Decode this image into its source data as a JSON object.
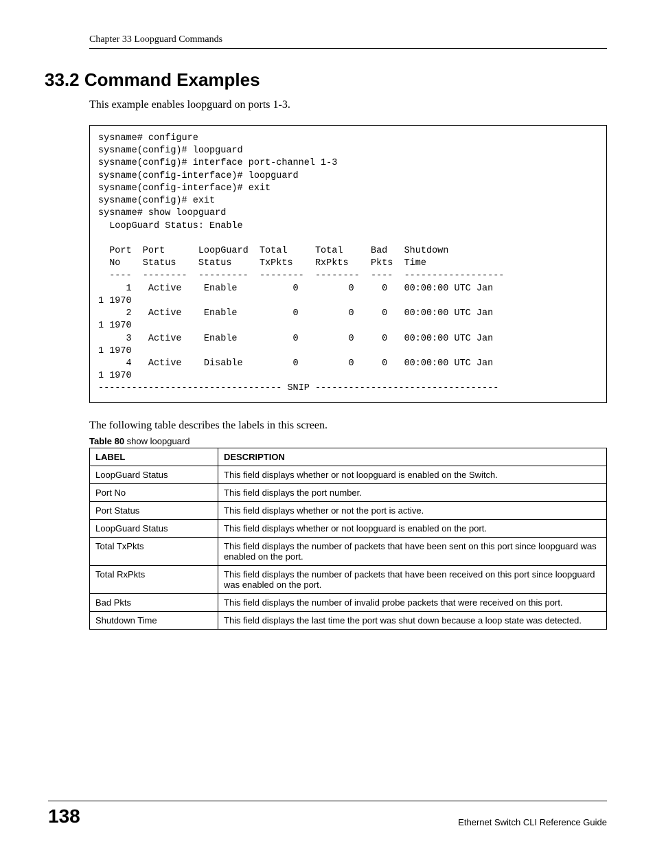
{
  "header": {
    "chapter": "Chapter 33 Loopguard Commands"
  },
  "section": {
    "title": "33.2  Command Examples",
    "intro": "This example enables loopguard on ports 1-3."
  },
  "code": "sysname# configure\nsysname(config)# loopguard\nsysname(config)# interface port-channel 1-3\nsysname(config-interface)# loopguard\nsysname(config-interface)# exit\nsysname(config)# exit\nsysname# show loopguard\n  LoopGuard Status: Enable\n\n  Port  Port      LoopGuard  Total     Total     Bad   Shutdown\n  No    Status    Status     TxPkts    RxPkts    Pkts  Time\n  ----  --------  ---------  --------  --------  ----  ------------------\n     1   Active    Enable          0         0     0   00:00:00 UTC Jan\n1 1970\n     2   Active    Enable          0         0     0   00:00:00 UTC Jan\n1 1970\n     3   Active    Enable          0         0     0   00:00:00 UTC Jan\n1 1970\n     4   Active    Disable         0         0     0   00:00:00 UTC Jan\n1 1970\n--------------------------------- SNIP ---------------------------------",
  "after_code": "The following table describes the labels in this screen.",
  "table": {
    "caption_bold": "Table 80",
    "caption_rest": "   show loopguard",
    "head_label": "LABEL",
    "head_desc": "DESCRIPTION",
    "rows": [
      {
        "label": "LoopGuard Status",
        "desc": "This field displays whether or not loopguard is enabled on the Switch."
      },
      {
        "label": "Port No",
        "desc": "This field displays the port number."
      },
      {
        "label": "Port Status",
        "desc": "This field displays whether or not the port is active."
      },
      {
        "label": "LoopGuard Status",
        "desc": "This field displays whether or not loopguard is enabled on the port."
      },
      {
        "label": "Total TxPkts",
        "desc": "This field displays the number of packets that have been sent on this port since loopguard was enabled on the port."
      },
      {
        "label": "Total RxPkts",
        "desc": "This field displays the number of packets that have been received on this port since loopguard was enabled on the port."
      },
      {
        "label": "Bad Pkts",
        "desc": "This field displays the number of invalid probe packets that were received on this port."
      },
      {
        "label": "Shutdown Time",
        "desc": "This field displays the last time the port was shut down because a loop state was detected."
      }
    ]
  },
  "footer": {
    "page": "138",
    "title": "Ethernet Switch CLI Reference Guide"
  }
}
